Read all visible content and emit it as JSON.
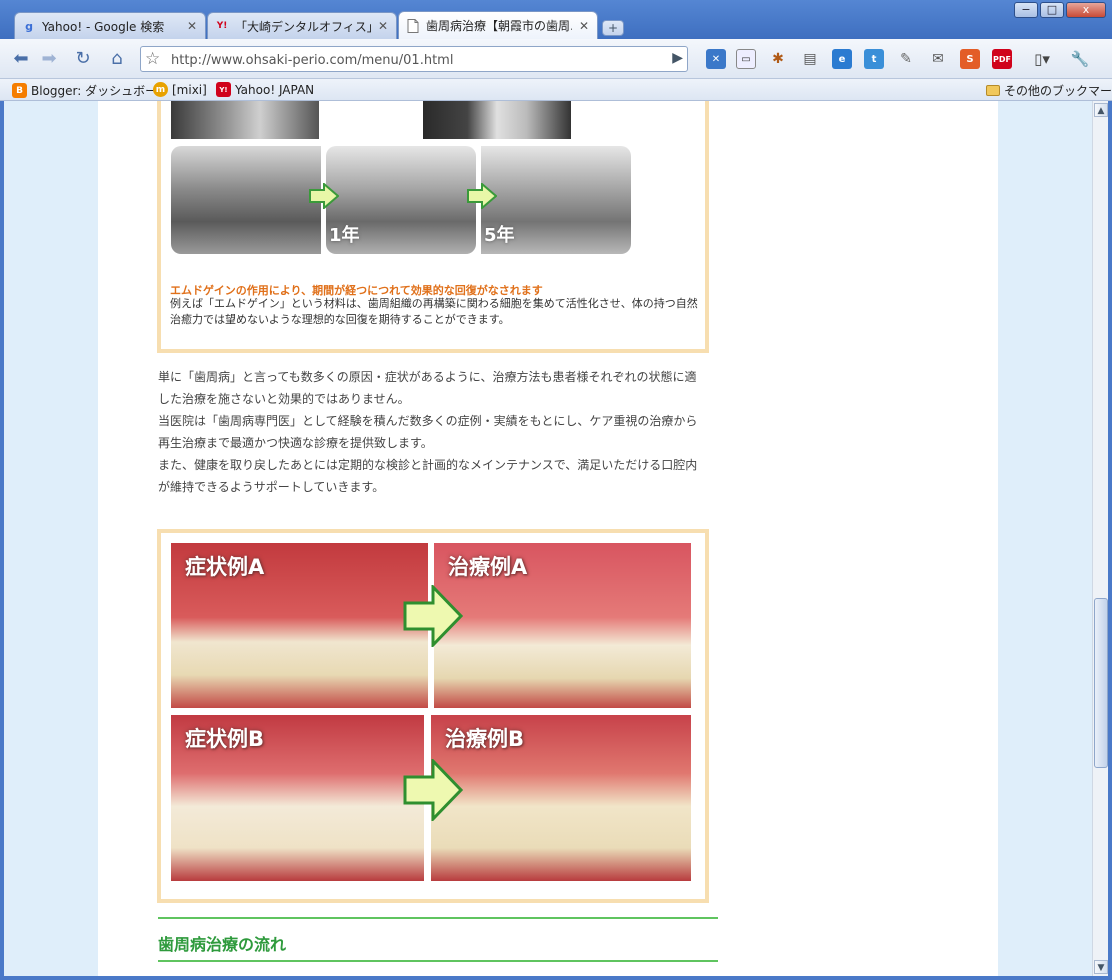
{
  "window": {
    "minimize": "−",
    "maximize": "□",
    "close": "x"
  },
  "tabs": [
    {
      "title": "Yahoo! - Google 検索",
      "icon": "g"
    },
    {
      "title": "「大崎デンタルオフィス」の検…",
      "icon": "Y!"
    },
    {
      "title": "歯周病治療【朝霞市の歯周…",
      "icon": ""
    }
  ],
  "newtab_label": "+",
  "toolbar": {
    "url": "http://www.ohsaki-perio.com/menu/01.html"
  },
  "bookmarks": [
    {
      "label": "Blogger: ダッシュボード",
      "icon": "B",
      "color": "#f57d00"
    },
    {
      "label": "[mixi]",
      "icon": "m",
      "color": "#e8a200"
    },
    {
      "label": "Yahoo! JAPAN",
      "icon": "Y!",
      "color": "#d0021b"
    }
  ],
  "other_bookmarks": "その他のブックマーク",
  "content": {
    "xray_labels": [
      "1年",
      "5年"
    ],
    "emdogain_heading": "エムドゲインの作用により、期間が経つにつれて効果的な回復がなされます",
    "emdogain_desc": "例えば「エムドゲイン」という材料は、歯周組織の再構築に関わる細胞を集めて活性化させ、体の持つ自然治癒力では望めないような理想的な回復を期待することができます。",
    "paragraphs": [
      "単に「歯周病」と言っても数多くの原因・症状があるように、治療方法も患者様それぞれの状態に適した治療を施さないと効果的ではありません。",
      "当医院は「歯周病専門医」として経験を積んだ数多くの症例・実績をもとにし、ケア重視の治療から再生治療まで最適かつ快適な診療を提供致します。",
      "また、健康を取り戻したあとには定期的な検診と計画的なメインテナンスで、満足いただける口腔内が維持できるようサポートしていきます。"
    ],
    "photo_labels": [
      "症状例A",
      "治療例A",
      "症状例B",
      "治療例B"
    ],
    "section_title": "歯周病治療の流れ"
  }
}
